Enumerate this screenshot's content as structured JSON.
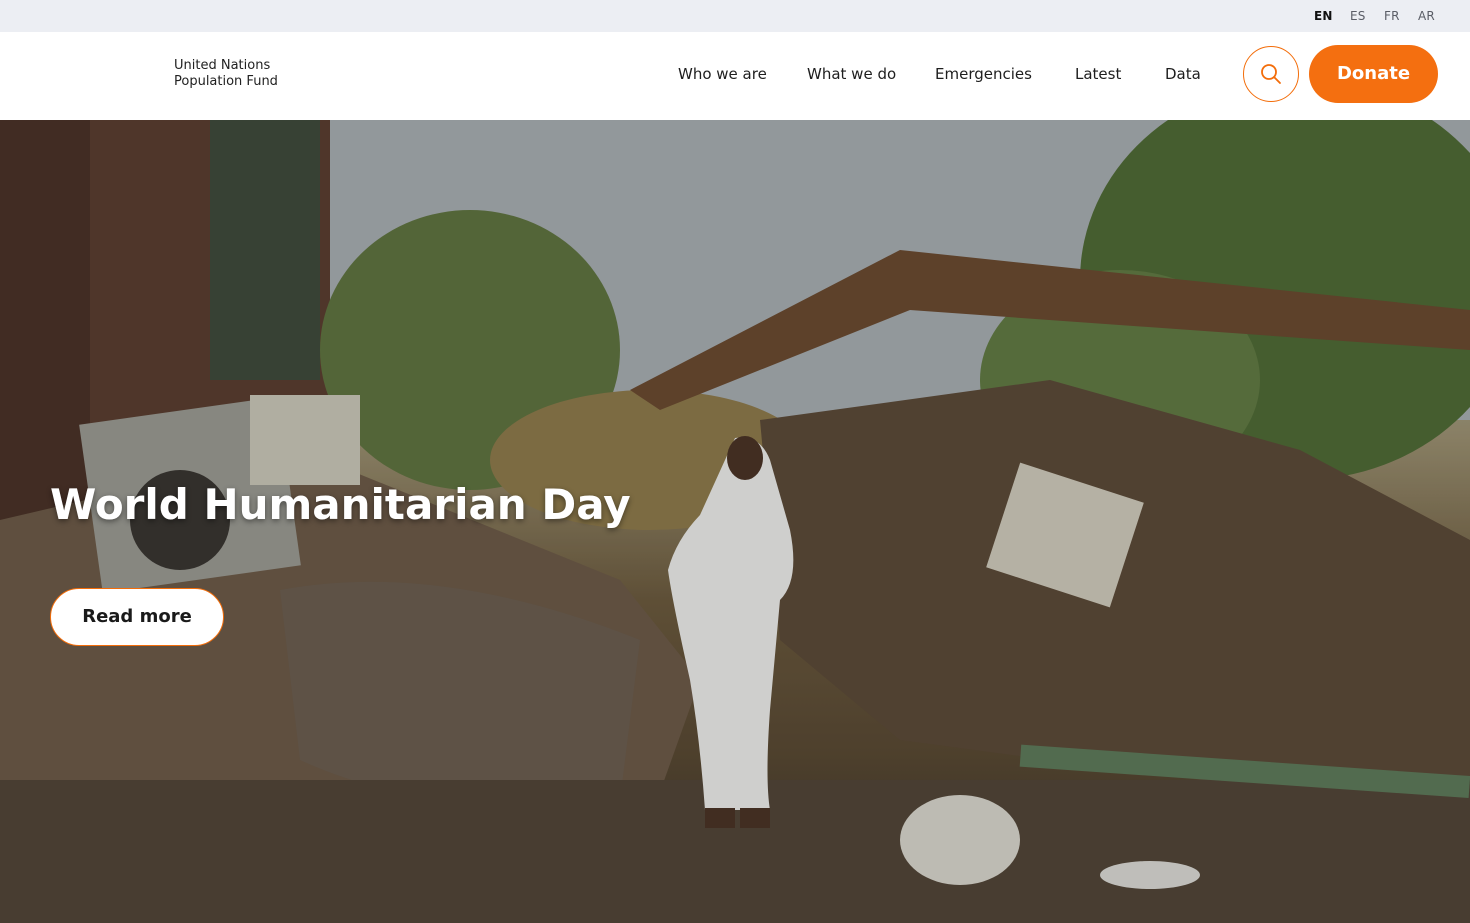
{
  "languages": [
    {
      "code": "EN",
      "active": true
    },
    {
      "code": "ES",
      "active": false
    },
    {
      "code": "FR",
      "active": false
    },
    {
      "code": "AR",
      "active": false
    }
  ],
  "header": {
    "brand_line1": "United Nations",
    "brand_line2": "Population Fund",
    "nav": [
      "Who we are",
      "What we do",
      "Emergencies",
      "Latest",
      "Data"
    ],
    "search_icon": "search-icon",
    "donate_label": "Donate"
  },
  "hero": {
    "title": "World Humanitarian Day",
    "cta_label": "Read more"
  },
  "colors": {
    "accent": "#f46f10",
    "langbar_bg": "#eceef3"
  }
}
